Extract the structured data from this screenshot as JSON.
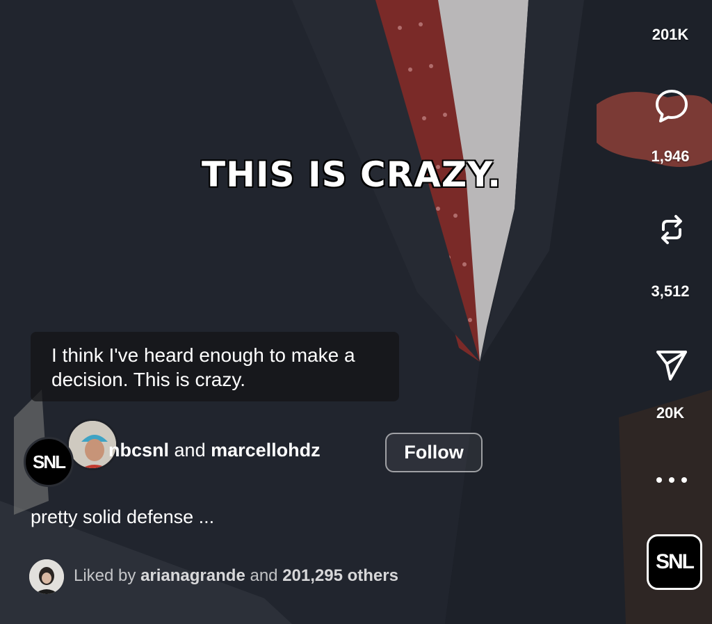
{
  "video": {
    "burned_caption": "THIS IS CRAZY.",
    "subtitle": "I think I've heard enough to make a decision. This is crazy."
  },
  "actions": {
    "like_count": "201K",
    "comment_count": "1,946",
    "repost_count": "3,512",
    "share_count": "20K"
  },
  "author": {
    "avatar_text": "SNL",
    "name1": "nbcsnl",
    "joiner": "and",
    "name2": "marcellohdz",
    "follow_label": "Follow"
  },
  "post": {
    "caption": "pretty solid defense ..."
  },
  "likes": {
    "prefix": "Liked by",
    "user": "arianagrande",
    "joiner": "and",
    "others": "201,295 others"
  },
  "audio": {
    "thumb_text": "SNL"
  },
  "colors": {
    "background": "#1a1d24",
    "tie": "#7a2a28",
    "text": "#ffffff"
  }
}
